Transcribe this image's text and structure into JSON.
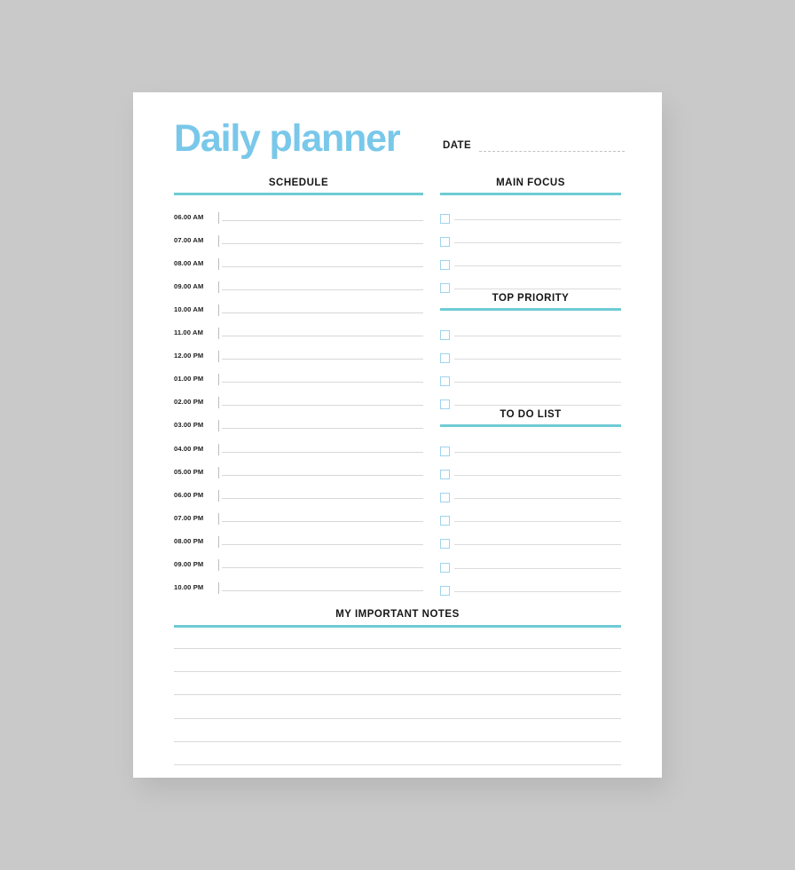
{
  "page": {
    "background_color": "#c9c9c9",
    "paper_color": "#ffffff",
    "accent_title_color": "#79c8ea",
    "accent_rule_color": "#6fcbd4",
    "checkbox_border_color": "#9ed4ec",
    "line_color": "#d8d8d8"
  },
  "header": {
    "title": "Daily planner",
    "date_label": "DATE",
    "date_value": ""
  },
  "schedule": {
    "title": "SCHEDULE",
    "times": [
      "06.00 AM",
      "07.00 AM",
      "08.00 AM",
      "09.00 AM",
      "10.00 AM",
      "11.00 AM",
      "12.00 PM",
      "01.00 PM",
      "02.00 PM",
      "03.00 PM",
      "04.00 PM",
      "05.00 PM",
      "06.00 PM",
      "07.00 PM",
      "08.00 PM",
      "09.00 PM",
      "10.00 PM"
    ],
    "entries": [
      "",
      "",
      "",
      "",
      "",
      "",
      "",
      "",
      "",
      "",
      "",
      "",
      "",
      "",
      "",
      "",
      ""
    ]
  },
  "main_focus": {
    "title": "MAIN FOCUS",
    "items": [
      {
        "checked": false,
        "text": ""
      },
      {
        "checked": false,
        "text": ""
      },
      {
        "checked": false,
        "text": ""
      },
      {
        "checked": false,
        "text": ""
      }
    ]
  },
  "top_priority": {
    "title": "TOP PRIORITY",
    "items": [
      {
        "checked": false,
        "text": ""
      },
      {
        "checked": false,
        "text": ""
      },
      {
        "checked": false,
        "text": ""
      },
      {
        "checked": false,
        "text": ""
      }
    ]
  },
  "to_do_list": {
    "title": "TO DO LIST",
    "items": [
      {
        "checked": false,
        "text": ""
      },
      {
        "checked": false,
        "text": ""
      },
      {
        "checked": false,
        "text": ""
      },
      {
        "checked": false,
        "text": ""
      },
      {
        "checked": false,
        "text": ""
      },
      {
        "checked": false,
        "text": ""
      },
      {
        "checked": false,
        "text": ""
      }
    ]
  },
  "notes": {
    "title": "MY IMPORTANT NOTES",
    "lines": [
      "",
      "",
      "",
      "",
      "",
      ""
    ]
  }
}
